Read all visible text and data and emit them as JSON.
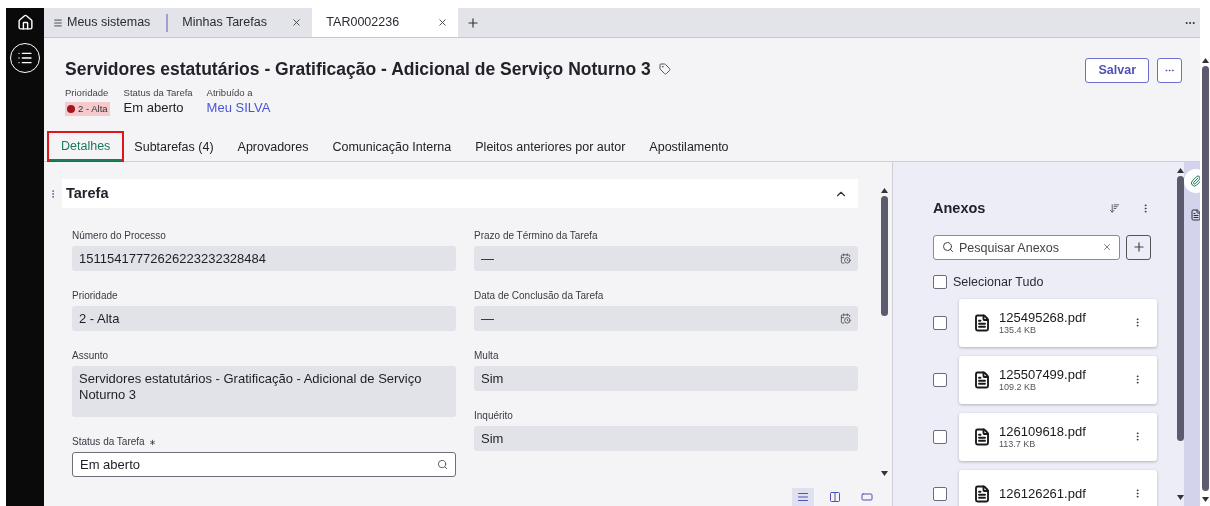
{
  "browser_tabs": [
    {
      "kind": "menu",
      "label": "Meus sistemas"
    },
    {
      "kind": "tab",
      "label": "Minhas Tarefas",
      "selected": false
    },
    {
      "kind": "tab",
      "label": "TAR0002236",
      "selected": true
    }
  ],
  "header": {
    "title": "Servidores estatutários - Gratificação - Adicional de Serviço Noturno 3",
    "meta": [
      {
        "kind": "badge",
        "label": "Prioridade",
        "value": "2 - Alta",
        "color": "#a3151f"
      },
      {
        "kind": "text",
        "label": "Status da Tarefa",
        "value": "Em aberto"
      },
      {
        "kind": "link",
        "label": "Atribuído a",
        "value": "Meu SILVA"
      }
    ],
    "save_button": "Salvar"
  },
  "tabs": [
    {
      "label": "Detalhes",
      "selected": true
    },
    {
      "label": "Subtarefas (4)",
      "selected": false
    },
    {
      "label": "Aprovadores",
      "selected": false
    },
    {
      "label": "Comunicação Interna",
      "selected": false
    },
    {
      "label": "Pleitos anteriores por autor",
      "selected": false
    },
    {
      "label": "Apostilamento",
      "selected": false
    }
  ],
  "section": {
    "title": "Tarefa",
    "expanded": true,
    "left_fields": [
      {
        "kind": "readonly",
        "label": "Número do Processo",
        "value": "15115417772626223232328484"
      },
      {
        "kind": "readonly",
        "label": "Prioridade",
        "value": "2 - Alta"
      },
      {
        "kind": "multiline",
        "label": "Assunto",
        "value": "Servidores estatutários - Gratificação - Adicional de Serviço Noturno 3"
      },
      {
        "kind": "search",
        "label": "Status da Tarefa",
        "required": true,
        "value": "Em aberto"
      }
    ],
    "right_fields": [
      {
        "kind": "date",
        "label": "Prazo de Término da Tarefa",
        "value": "—"
      },
      {
        "kind": "date",
        "label": "Data de Conclusão da Tarefa",
        "value": "—"
      },
      {
        "kind": "readonly",
        "label": "Multa",
        "value": "Sim"
      },
      {
        "kind": "readonly",
        "label": "Inquérito",
        "value": "Sim"
      }
    ]
  },
  "view_modes": [
    {
      "kind": "list",
      "selected": true
    },
    {
      "kind": "split",
      "selected": false
    },
    {
      "kind": "single",
      "selected": false
    }
  ],
  "attachments": {
    "title": "Anexos",
    "search": {
      "placeholder": "Pesquisar Anexos"
    },
    "select_all": {
      "label": "Selecionar Tudo",
      "checked": false
    },
    "files": [
      {
        "name": "125495268.pdf",
        "size": "135.4 KB",
        "checked": false
      },
      {
        "name": "125507499.pdf",
        "size": "109.2 KB",
        "checked": false
      },
      {
        "name": "126109618.pdf",
        "size": "113.7 KB",
        "checked": false
      },
      {
        "name": "126126261.pdf",
        "checked": false
      }
    ]
  },
  "side_rail": [
    {
      "kind": "attachment",
      "selected": true
    },
    {
      "kind": "document",
      "selected": false
    }
  ]
}
